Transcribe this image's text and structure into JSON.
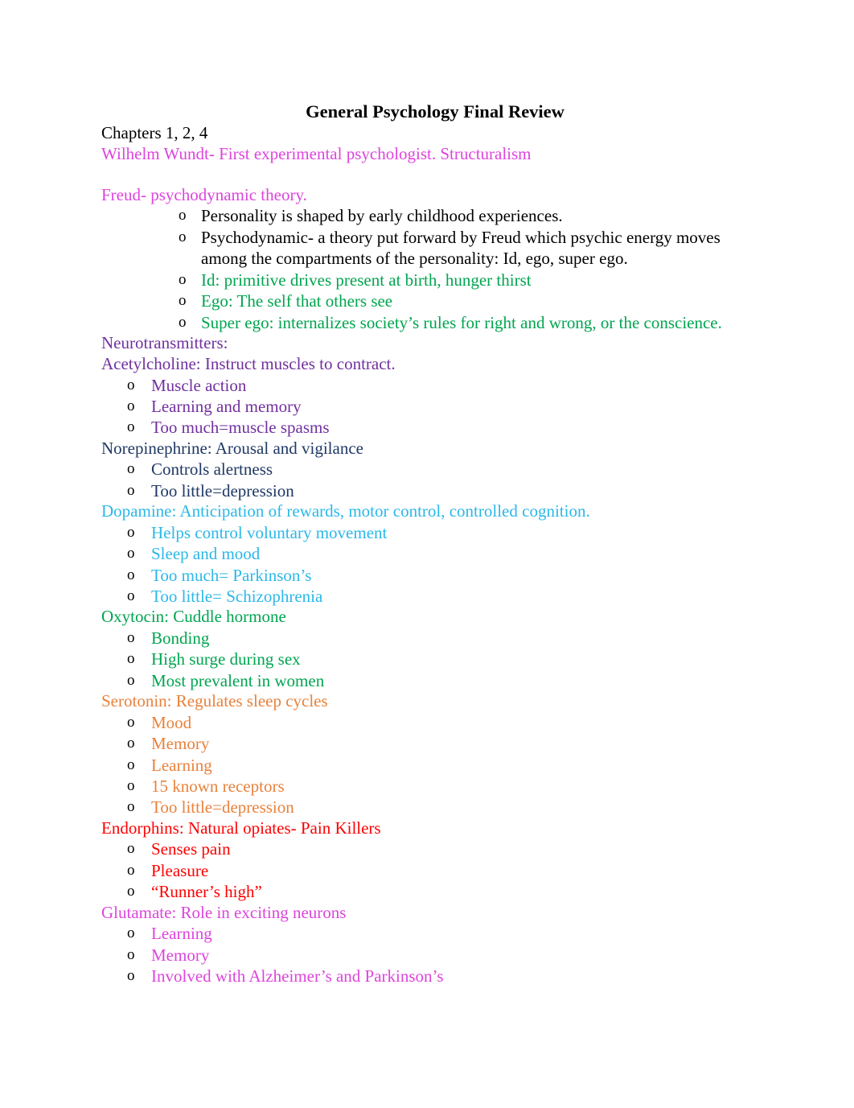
{
  "document": {
    "title": "General Psychology Final Review",
    "bullet_glyph": "o"
  },
  "colors": {
    "black": "#000000",
    "magenta": "#DD44DD",
    "purple": "#7030A0",
    "navy": "#1F3864",
    "green": "#00A550",
    "cyan": "#2BB8E8",
    "orange": "#E8823C",
    "red": "#FF0000"
  },
  "body": {
    "chapters_line": "Chapters 1, 2, 4",
    "wundt_line": "Wilhelm Wundt- First experimental psychologist. Structuralism",
    "freud_heading": "Freud- psychodynamic theory.",
    "freud_items": [
      {
        "text": "Personality is shaped by early childhood experiences.",
        "color": "black"
      },
      {
        "text": "Psychodynamic- a theory put forward by Freud which psychic energy moves",
        "text2": "among the compartments of the personality: Id, ego, super ego.",
        "color": "black"
      },
      {
        "text": "Id: primitive drives present at birth, hunger thirst",
        "color": "green"
      },
      {
        "text": "Ego: The self that others see",
        "color": "green"
      },
      {
        "text": "Super ego: internalizes society’s rules for right and wrong, or the conscience.",
        "color": "green"
      }
    ],
    "neurotransmitters_heading": "Neurotransmitters:",
    "sections": [
      {
        "heading": "Acetylcholine: Instruct muscles to contract.",
        "color": "purple",
        "items": [
          "Muscle action",
          "Learning and memory",
          "Too much=muscle spasms"
        ]
      },
      {
        "heading": "Norepinephrine: Arousal and vigilance",
        "color": "navy",
        "items": [
          "Controls alertness",
          "Too little=depression"
        ]
      },
      {
        "heading": "Dopamine: Anticipation of rewards, motor control, controlled cognition.",
        "color": "cyan",
        "items": [
          "Helps control voluntary movement",
          "Sleep and mood",
          "Too much= Parkinson’s",
          "Too little= Schizophrenia"
        ]
      },
      {
        "heading": "Oxytocin: Cuddle hormone",
        "color": "green",
        "items": [
          "Bonding",
          "High surge during sex",
          "Most prevalent in women"
        ]
      },
      {
        "heading": "Serotonin: Regulates sleep cycles",
        "color": "orange",
        "items": [
          "Mood",
          "Memory",
          "Learning",
          "15 known receptors",
          "Too little=depression"
        ]
      },
      {
        "heading": "Endorphins: Natural opiates- Pain Killers",
        "color": "red",
        "items": [
          "Senses pain",
          "Pleasure",
          "“Runner’s high”"
        ]
      },
      {
        "heading": "Glutamate: Role in exciting neurons",
        "color": "magenta",
        "items": [
          "Learning",
          "Memory",
          "Involved with Alzheimer’s and Parkinson’s"
        ]
      }
    ]
  }
}
